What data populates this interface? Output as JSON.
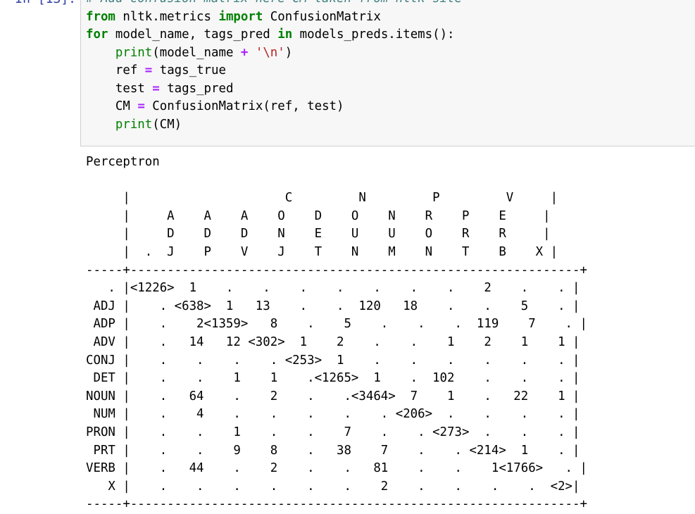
{
  "cell": {
    "prompt": "In [13]:",
    "code": {
      "comment": "# Add confusion matrix here CM taken from nltk site",
      "from_kw": "from",
      "module": " nltk.metrics ",
      "import_kw": "import",
      "imported": " ConfusionMatrix",
      "for_kw": "for",
      "for_vars": " model_name, tags_pred ",
      "in_kw": "in",
      "for_iter": " models_preds.items():",
      "indent": "    ",
      "print1_fn": "print",
      "print1_open": "(model_name ",
      "plus": "+",
      "print1_str": "'\\n'",
      "print1_close": ")",
      "ref_var": "ref ",
      "eq": "=",
      "ref_val": " tags_true",
      "test_var": "test ",
      "test_val": " tags_pred",
      "cm_var": "CM ",
      "cm_val": " ConfusionMatrix(ref, test)",
      "print2_fn": "print",
      "print2_args": "(CM)"
    }
  },
  "output": {
    "title": "Perceptron",
    "matrix_lines": [
      "     |                     C         N         P         V     |",
      "     |     A    A    A    O    D    O    N    R    P    E     |",
      "     |     D    D    D    N    E    U    U    O    R    R     |",
      "     |  .  J    P    V    J    T    N    M    N    T    B    X |",
      "-----+-------------------------------------------------------------+",
      "   . |<1226>  1    .    .    .    .    .    .    .    2    .    . |",
      " ADJ |    . <638>  1   13    .    .  120   18    .    .    5    . |",
      " ADP |    .    2<1359>   8    .    5    .    .    .  119    7    . |",
      " ADV |    .   14   12 <302>  1    2    .    .    1    2    1    1 |",
      "CONJ |    .    .    .    . <253>  1    .    .    .    .    .    . |",
      " DET |    .    .    1    1    .<1265>  1    .  102    .    .    . |",
      "NOUN |    .   64    .    2    .    .<3464>  7    1    .   22    1 |",
      " NUM |    .    4    .    .    .    .    . <206>  .    .    .    . |",
      "PRON |    .    .    1    .    .    7    .    . <273>  .    .    . |",
      " PRT |    .    .    9    8    .   38    7    .    . <214>  1    . |",
      "VERB |    .   44    .    2    .    .   81    .    .    1<1766>   . |",
      "   X |    .    .    .    .    .    .    2    .    .    .    .  <2>|",
      "-----+-------------------------------------------------------------+"
    ]
  }
}
